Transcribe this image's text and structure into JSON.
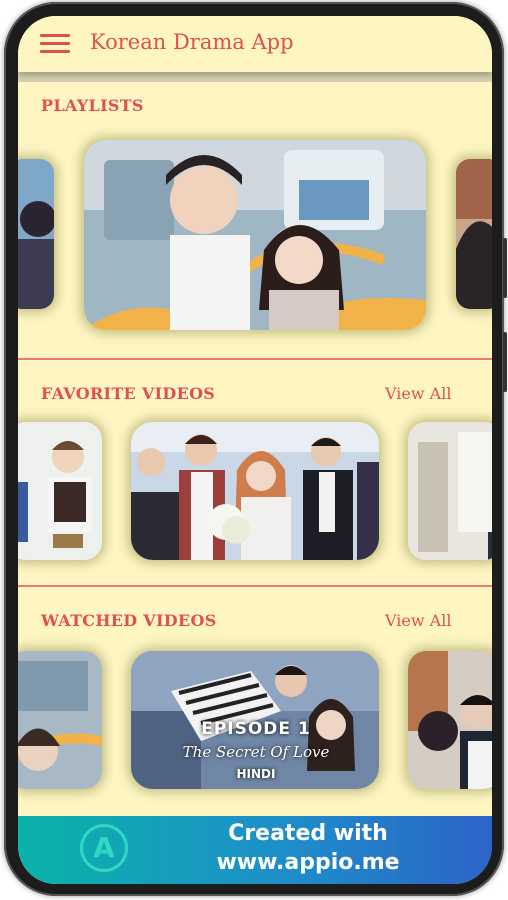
{
  "app": {
    "title": "Korean Drama App"
  },
  "sections": {
    "playlists": {
      "title": "PLAYLISTS"
    },
    "favorites": {
      "title": "FAVORITE VIDEOS",
      "view_all": "View All"
    },
    "watched": {
      "title": "WATCHED VIDEOS",
      "view_all": "View All"
    }
  },
  "watched_featured": {
    "episode": "EPISODE 1",
    "subtitle": "The Secret Of Love",
    "language": "HINDI"
  },
  "banner": {
    "line1": "Created with",
    "line2": "www.appio.me"
  },
  "colors": {
    "accent": "#e0504e",
    "background": "#fdf6c3",
    "banner_start": "#0bb3a8",
    "banner_end": "#2c63c8"
  }
}
